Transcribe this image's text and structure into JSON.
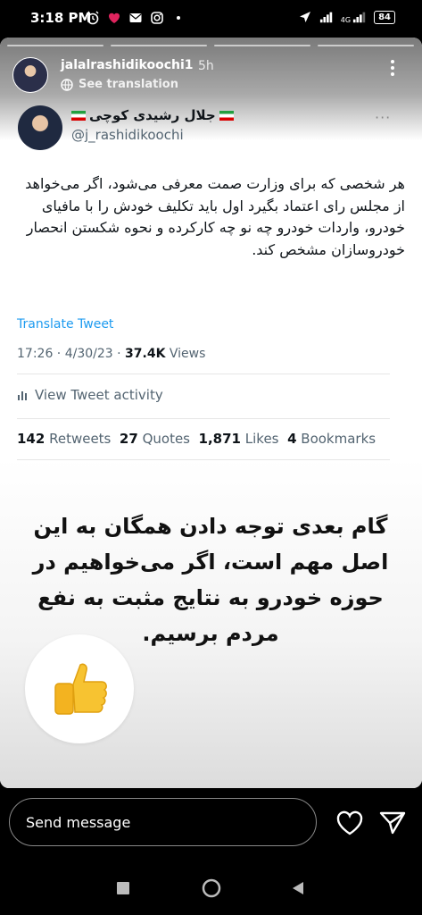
{
  "status_bar": {
    "time": "3:18 PM",
    "network": "4G",
    "battery": "84"
  },
  "story": {
    "username": "jalalrashidikoochi1",
    "posted_ago": "5h",
    "see_translation": "See translation"
  },
  "tweet": {
    "display_name": "جلال رشیدی کوچی",
    "handle": "@j_rashidikoochi",
    "text": "هر شخصی که برای وزارت صمت معرفی می‌شود، اگر می‌خواهد از مجلس رای اعتماد بگیرد اول باید تکلیف خودش را با مافیای خودرو، واردات خودرو چه نو چه کارکرده و نحوه شکستن انحصار خودروسازان مشخص کند.",
    "translate_label": "Translate Tweet",
    "time": "17:26 · 4/30/23 ·",
    "views_count": "37.4K",
    "views_label": "Views",
    "activity_label": "View Tweet activity",
    "retweets_count": "142",
    "retweets_label": "Retweets",
    "quotes_count": "27",
    "quotes_label": "Quotes",
    "likes_count": "1,871",
    "likes_label": "Likes",
    "bookmarks_count": "4",
    "bookmarks_label": "Bookmarks"
  },
  "caption": "گام بعدی توجه دادن همگان به این اصل مهم است، اگر می‌خواهیم در حوزه خودرو به نتایج مثبت به نفع مردم برسیم.",
  "sticker": "thumbs-up-icon",
  "composer": {
    "placeholder": "Send message"
  },
  "colors": {
    "link": "#1d9bf0",
    "muted": "#536471",
    "text": "#0f1419"
  }
}
